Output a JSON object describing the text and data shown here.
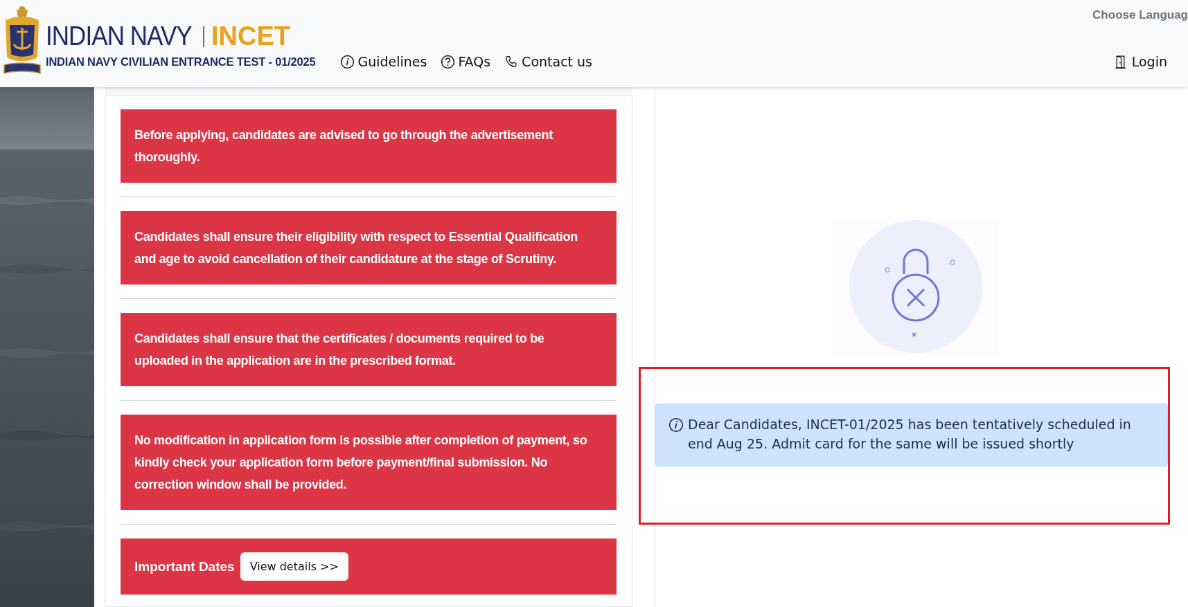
{
  "header": {
    "brand": "INDIAN NAVY",
    "brand_accent": "INCET",
    "subtitle": "INDIAN NAVY CIVILIAN ENTRANCE TEST - 01/2025",
    "nav": [
      {
        "label": "Guidelines",
        "kind": "info"
      },
      {
        "label": "FAQs",
        "kind": "help"
      },
      {
        "label": "Contact us",
        "kind": "phone"
      }
    ],
    "language": "Choose Languag",
    "login": "Login"
  },
  "notices": [
    {
      "text": "Before applying, candidates are advised to go through the advertisement thoroughly."
    },
    {
      "text": "Candidates shall ensure their eligibility with respect to Essential Qualification and age to avoid cancellation of their candidature at the stage of Scrutiny."
    },
    {
      "text": "Candidates shall ensure that the certificates / documents required to be uploaded in the application are in the prescribed format."
    },
    {
      "text": "No modification in application form is possible after completion of payment, so kindly check your application form before payment/final submission. No correction window shall be provided."
    }
  ],
  "important_dates": {
    "label": "Important Dates",
    "button": "View details >>"
  },
  "alert": {
    "text": "Dear Candidates, INCET-01/2025 has been tentatively scheduled in end Aug 25. Admit card for the same will be issued shortly"
  }
}
